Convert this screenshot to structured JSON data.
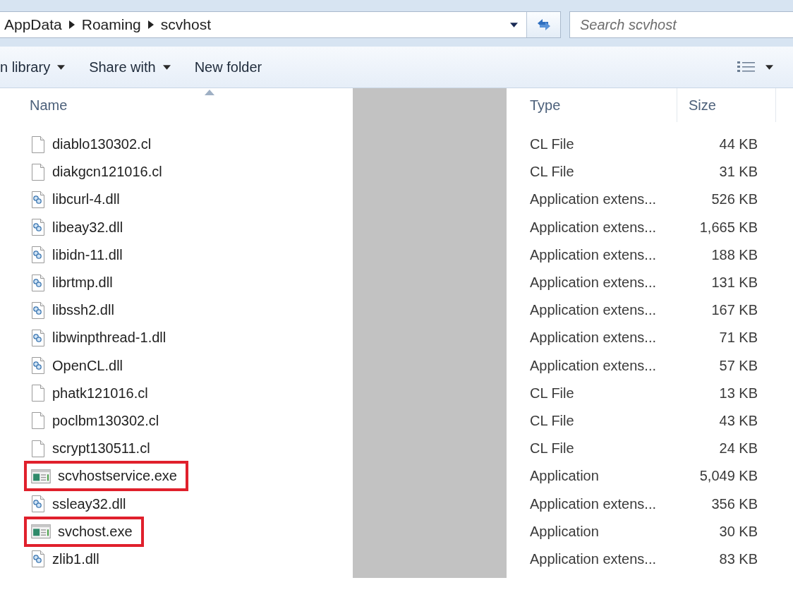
{
  "address_bar": {
    "breadcrumbs": [
      "AppData",
      "Roaming",
      "scvhost"
    ]
  },
  "search": {
    "placeholder": "Search scvhost"
  },
  "toolbar": [
    {
      "label": "n library",
      "dropdown": true
    },
    {
      "label": "Share with",
      "dropdown": true
    },
    {
      "label": "New folder",
      "dropdown": false
    }
  ],
  "columns": [
    {
      "label": "Name",
      "sorted": true
    },
    {
      "label": "Type",
      "sorted": false
    },
    {
      "label": "Size",
      "sorted": false
    }
  ],
  "files": [
    {
      "name": "diablo130302.cl",
      "kind": "file",
      "type": "CL File",
      "size": "44 KB",
      "highlighted": false
    },
    {
      "name": "diakgcn121016.cl",
      "kind": "file",
      "type": "CL File",
      "size": "31 KB",
      "highlighted": false
    },
    {
      "name": "libcurl-4.dll",
      "kind": "dll",
      "type": "Application extens...",
      "size": "526 KB",
      "highlighted": false
    },
    {
      "name": "libeay32.dll",
      "kind": "dll",
      "type": "Application extens...",
      "size": "1,665 KB",
      "highlighted": false
    },
    {
      "name": "libidn-11.dll",
      "kind": "dll",
      "type": "Application extens...",
      "size": "188 KB",
      "highlighted": false
    },
    {
      "name": "librtmp.dll",
      "kind": "dll",
      "type": "Application extens...",
      "size": "131 KB",
      "highlighted": false
    },
    {
      "name": "libssh2.dll",
      "kind": "dll",
      "type": "Application extens...",
      "size": "167 KB",
      "highlighted": false
    },
    {
      "name": "libwinpthread-1.dll",
      "kind": "dll",
      "type": "Application extens...",
      "size": "71 KB",
      "highlighted": false
    },
    {
      "name": "OpenCL.dll",
      "kind": "dll",
      "type": "Application extens...",
      "size": "57 KB",
      "highlighted": false
    },
    {
      "name": "phatk121016.cl",
      "kind": "file",
      "type": "CL File",
      "size": "13 KB",
      "highlighted": false
    },
    {
      "name": "poclbm130302.cl",
      "kind": "file",
      "type": "CL File",
      "size": "43 KB",
      "highlighted": false
    },
    {
      "name": "scrypt130511.cl",
      "kind": "file",
      "type": "CL File",
      "size": "24 KB",
      "highlighted": false
    },
    {
      "name": "scvhostservice.exe",
      "kind": "exe",
      "type": "Application",
      "size": "5,049 KB",
      "highlighted": true
    },
    {
      "name": "ssleay32.dll",
      "kind": "dll",
      "type": "Application extens...",
      "size": "356 KB",
      "highlighted": false
    },
    {
      "name": "svchost.exe",
      "kind": "exe",
      "type": "Application",
      "size": "30 KB",
      "highlighted": true
    },
    {
      "name": "zlib1.dll",
      "kind": "dll",
      "type": "Application extens...",
      "size": "83 KB",
      "highlighted": false
    }
  ]
}
